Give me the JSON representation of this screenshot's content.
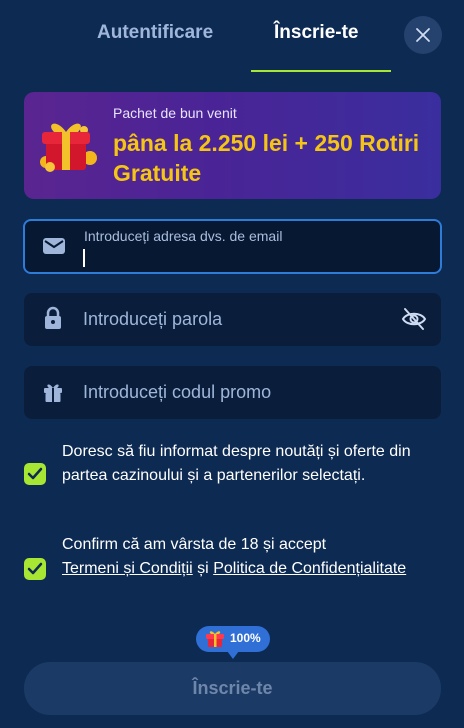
{
  "tabs": {
    "login_label": "Autentificare",
    "signup_label": "Înscrie-te",
    "active": "signup"
  },
  "close_icon": "close-icon",
  "banner": {
    "subtitle": "Pachet de bun venit",
    "title": "pâna la 2.250 lei + 250 Rotiri Gratuite",
    "icon": "gift-icon"
  },
  "form": {
    "email": {
      "placeholder": "Introduceți adresa dvs. de email",
      "value": "",
      "icon": "mail-icon"
    },
    "password": {
      "placeholder": "Introduceți parola",
      "value": "",
      "icon": "lock-icon",
      "toggle_icon": "eye-off-icon"
    },
    "promo": {
      "placeholder": "Introduceți codul promo",
      "value": "",
      "icon": "gift-icon"
    }
  },
  "consents": {
    "marketing": {
      "checked": true,
      "text": "Doresc să fiu informat despre noutăți și oferte din partea cazinoului și a partenerilor selectați."
    },
    "terms": {
      "checked": true,
      "prefix": "Confirm că am vârsta de 18 și accept",
      "terms_link": "Termeni și Condiții",
      "connector": "și",
      "privacy_link": "Politica de Confidențialitate"
    }
  },
  "progress_badge": {
    "text": "100%",
    "value_percent": 100,
    "icon": "gift-icon"
  },
  "submit": {
    "label": "Înscrie-te",
    "enabled": false
  },
  "colors": {
    "background": "#0d2a52",
    "accent_green": "#a7e633",
    "banner_gold": "#f5c515",
    "focus_blue": "#2e7bd8"
  }
}
